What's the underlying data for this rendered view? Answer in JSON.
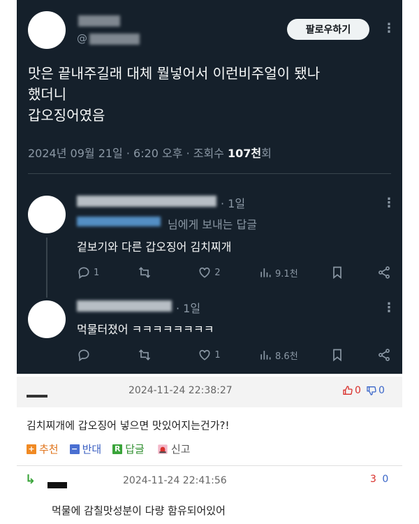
{
  "tweet": {
    "handle_prefix": "@",
    "follow_label": "팔로우하기",
    "body_lines": [
      "맛은 끝내주길래 대체 뭘넣어서 이런비주얼이 됐나",
      "했더니",
      "갑오징어였음"
    ],
    "meta_prefix": "2024년 09월 21일 · 6:20 오후 · 조회수 ",
    "meta_views": "107천",
    "meta_suffix": "회"
  },
  "replies": [
    {
      "time": "· 1일",
      "reply_to_suffix": "님에게 보내는 답글",
      "text": "겉보기와 다른 갑오징어 김치찌개",
      "replies": "1",
      "retweets": "",
      "likes": "2",
      "views": "9.1천"
    },
    {
      "time": "· 1일",
      "text": "먹물터졌어 ㅋㅋㅋㅋㅋㅋㅋㅋ",
      "replies": "",
      "retweets": "",
      "likes": "1",
      "views": "8.6천"
    }
  ],
  "comment1": {
    "date": "2024-11-24 22:38:27",
    "up": "0",
    "down": "0",
    "text": "김치찌개에 갑오징어 넣으면 맛있어지는건가?!",
    "buttons": {
      "recommend_icon": "+",
      "recommend": "추천",
      "oppose_icon": "−",
      "oppose": "반대",
      "reply_icon": "R",
      "reply": "답글",
      "report": "신고"
    }
  },
  "comment2": {
    "arrow": "↳",
    "date": "2024-11-24 22:41:56",
    "score_red": "3",
    "score_blue": "0",
    "text": "먹물에 감칠맛성분이 다량 함유되어있어"
  },
  "colors": {
    "tweet_bg": "#15202b",
    "up_red": "#d9302c",
    "down_blue": "#3a66c9",
    "recommend_orange": "#f08a24",
    "oppose_blue": "#4a6fd1",
    "reply_green": "#3aa43a"
  },
  "icons": [
    "more-icon",
    "reply-icon",
    "retweet-icon",
    "like-icon",
    "views-icon",
    "bookmark-icon",
    "share-icon",
    "thumbs-up-icon",
    "thumbs-down-icon",
    "siren-icon",
    "reply-arrow-icon"
  ]
}
